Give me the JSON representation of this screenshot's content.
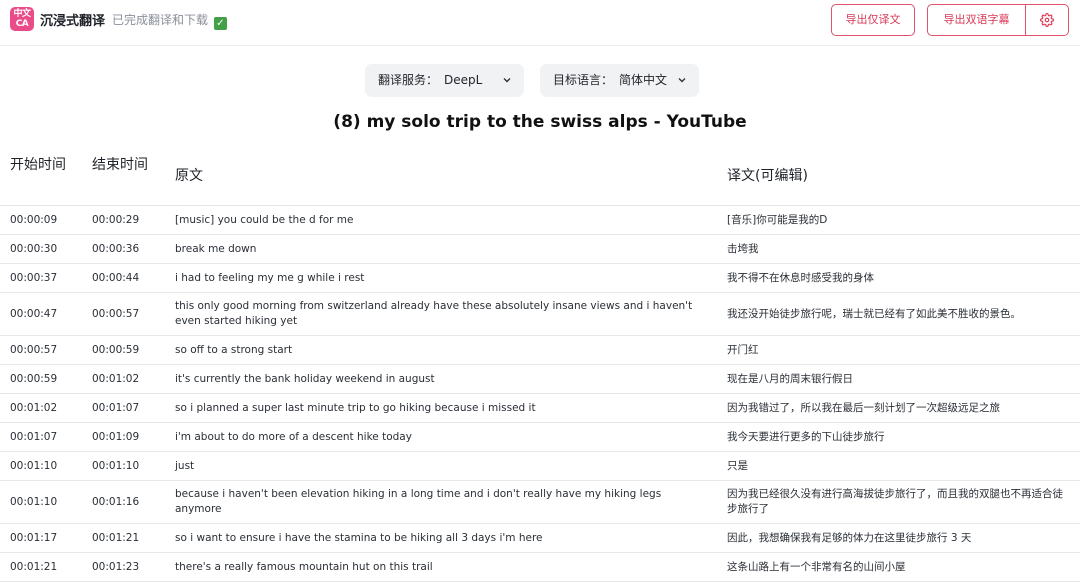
{
  "header": {
    "logo_top": "中文",
    "logo_bottom": "CA",
    "app_name": "沉浸式翻译",
    "status": "已完成翻译和下载",
    "status_icon": "check-mark-icon",
    "export_translation_label": "导出仅译文",
    "export_bilingual_label": "导出双语字幕",
    "settings_icon": "gear-icon",
    "accent_color": "#e0536b"
  },
  "controls": {
    "service_label": "翻译服务：",
    "service_value": "DeepL",
    "language_label": "目标语言：",
    "language_value": "简体中文"
  },
  "page_title": "(8) my solo trip to the swiss alps - YouTube",
  "table": {
    "columns": {
      "start": "开始时间",
      "end": "结束时间",
      "original": "原文",
      "translation": "译文(可编辑)"
    },
    "rows": [
      {
        "start": "00:00:09",
        "end": "00:00:29",
        "original": "[music] you could be the d for me",
        "translation": "[音乐]你可能是我的D"
      },
      {
        "start": "00:00:30",
        "end": "00:00:36",
        "original": "break me down",
        "translation": "击垮我"
      },
      {
        "start": "00:00:37",
        "end": "00:00:44",
        "original": "i had to feeling my me g while i rest",
        "translation": "我不得不在休息时感受我的身体"
      },
      {
        "start": "00:00:47",
        "end": "00:00:57",
        "original": "this only good morning from switzerland already have these absolutely insane views and i haven't even started hiking yet",
        "translation": "我还没开始徒步旅行呢，瑞士就已经有了如此美不胜收的景色。"
      },
      {
        "start": "00:00:57",
        "end": "00:00:59",
        "original": "so off to a strong start",
        "translation": "开门红"
      },
      {
        "start": "00:00:59",
        "end": "00:01:02",
        "original": "it's currently the bank holiday weekend in august",
        "translation": "现在是八月的周末银行假日"
      },
      {
        "start": "00:01:02",
        "end": "00:01:07",
        "original": "so i planned a super last minute trip to go hiking because i missed it",
        "translation": "因为我错过了，所以我在最后一刻计划了一次超级远足之旅"
      },
      {
        "start": "00:01:07",
        "end": "00:01:09",
        "original": "i'm about to do more of a descent hike today",
        "translation": "我今天要进行更多的下山徒步旅行"
      },
      {
        "start": "00:01:10",
        "end": "00:01:10",
        "original": "just",
        "translation": "只是"
      },
      {
        "start": "00:01:10",
        "end": "00:01:16",
        "original": "because i haven't been elevation hiking in a long time and i don't really have my hiking legs anymore",
        "translation": "因为我已经很久没有进行高海拔徒步旅行了，而且我的双腿也不再适合徒步旅行了"
      },
      {
        "start": "00:01:17",
        "end": "00:01:21",
        "original": "so i want to ensure i have the stamina to be hiking all 3 days i'm here",
        "translation": "因此，我想确保我有足够的体力在这里徒步旅行 3 天"
      },
      {
        "start": "00:01:21",
        "end": "00:01:23",
        "original": "there's a really famous mountain hut on this trail",
        "translation": "这条山路上有一个非常有名的山间小屋"
      }
    ]
  }
}
